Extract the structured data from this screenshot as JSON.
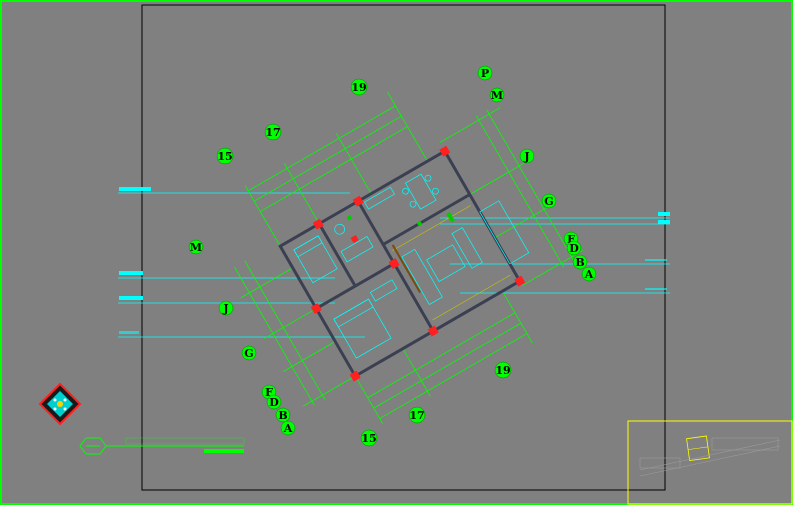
{
  "colors": {
    "background": "#808080",
    "border": "#00ff00",
    "sheet_frame": "#000000",
    "wall": "#3a3f52",
    "dimension": "#00ff00",
    "furniture": "#00ffff",
    "door_marker": "#ff0000",
    "viewport_frame": "#ffff00",
    "bubble_fill": "#00ff00",
    "bubble_text": "#000000"
  },
  "grid_bubbles": {
    "top": [
      "P",
      "M",
      "J",
      "G",
      "F",
      "D",
      "B",
      "A"
    ],
    "top_numbers": [
      "19",
      "17",
      "15"
    ],
    "left": [
      "M",
      "J",
      "G",
      "F",
      "D",
      "B",
      "A"
    ],
    "bottom_numbers": [
      "19",
      "17",
      "15"
    ]
  },
  "title_block": {
    "symbol": "",
    "title": "",
    "icon": "compass-rose-icon"
  },
  "viewport_preview": {
    "icon": "floor-plan-thumbnail-icon"
  }
}
